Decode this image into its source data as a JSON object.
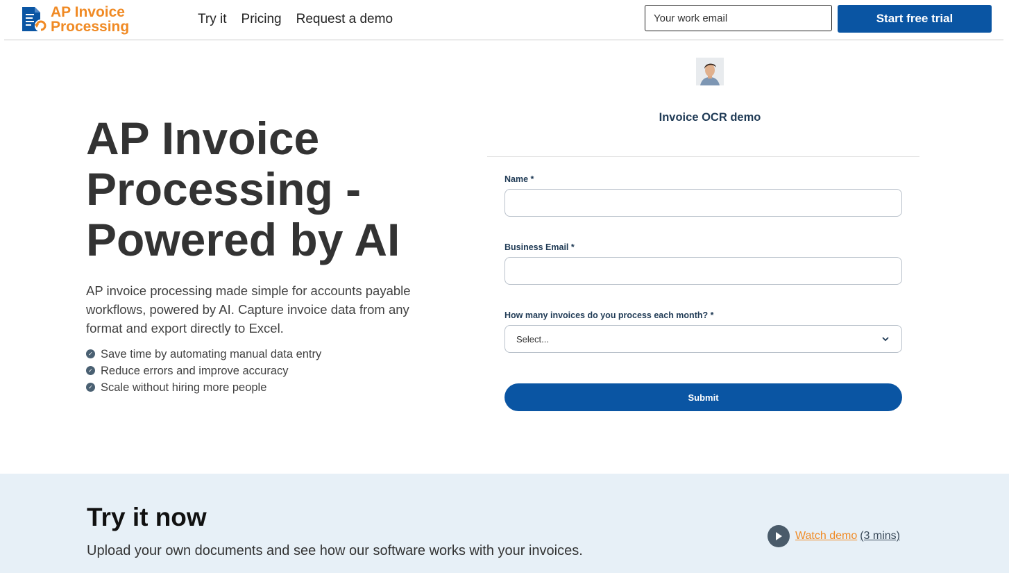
{
  "header": {
    "logo_line1": "AP Invoice",
    "logo_line2": "Processing",
    "nav": [
      "Try it",
      "Pricing",
      "Request a demo"
    ],
    "email_placeholder": "Your work email",
    "trial_button": "Start free trial"
  },
  "hero": {
    "title": "AP Invoice Processing - Powered by AI",
    "description": "AP invoice processing made simple for accounts payable workflows, powered by AI. Capture invoice data from any format and export directly to Excel.",
    "bullets": [
      "Save time by automating manual data entry",
      "Reduce errors and improve accuracy",
      "Scale without hiring more people"
    ]
  },
  "form": {
    "heading": "Invoice OCR demo",
    "name_label": "Name *",
    "email_label": "Business Email *",
    "invoices_label": "How many invoices do you process each month? *",
    "select_value": "Select...",
    "submit_label": "Submit"
  },
  "try_section": {
    "title": "Try it now",
    "subtitle": "Upload your own documents and see how our software works with your invoices.",
    "watch_label": "Watch demo ",
    "watch_duration": "(3 mins)"
  },
  "colors": {
    "brand_blue": "#0a55a3",
    "brand_orange": "#f08a24",
    "section_bg": "#e7f0f7"
  }
}
